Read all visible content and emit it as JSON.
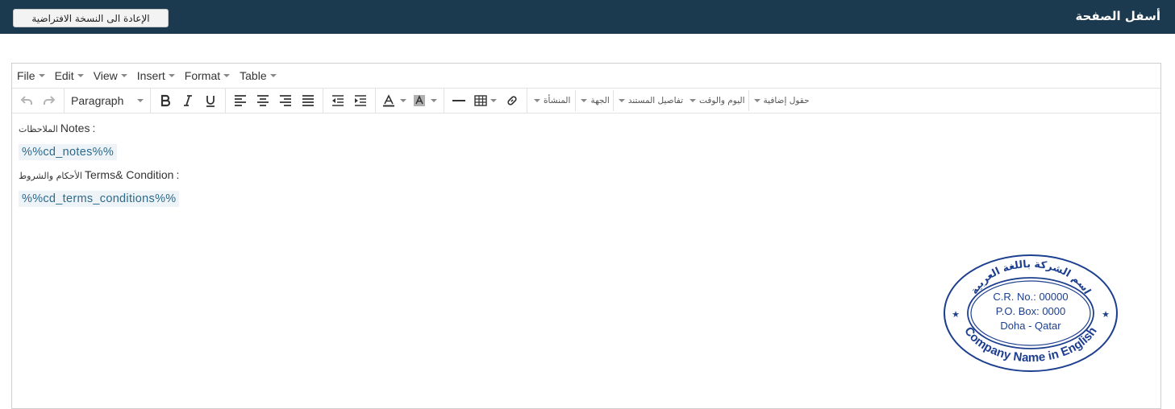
{
  "header": {
    "title": "أسفل الصفحة",
    "reset_button": "الإعادة الى النسخة الافتراضية"
  },
  "menubar": [
    {
      "label": "File"
    },
    {
      "label": "Edit"
    },
    {
      "label": "View"
    },
    {
      "label": "Insert"
    },
    {
      "label": "Format"
    },
    {
      "label": "Table"
    }
  ],
  "toolbar": {
    "block_format": "Paragraph",
    "custom_menus": [
      "المنشأة",
      "الجهة",
      "تفاصيل المستند",
      "اليوم والوقت",
      "حقول إضافية"
    ]
  },
  "content": {
    "notes_label_ar": "الملاحظات",
    "notes_label_en": "Notes",
    "notes_colon": ":",
    "notes_placeholder": "%%cd_notes%%",
    "terms_label_ar": "الأحكام والشروط",
    "terms_label_en": "Terms& Condition",
    "terms_colon": ":",
    "terms_placeholder": "%%cd_terms_conditions%%"
  },
  "stamp": {
    "arabic_name": "اسم الشركة باللغة العربية",
    "cr_line": "C.R. No.: 00000",
    "po_line": "P.O. Box: 0000",
    "city_line": "Doha - Qatar",
    "english_name": "Company Name in English",
    "color": "#1d3f8f"
  },
  "colors": {
    "header_bg": "#1b3a4f",
    "placeholder_text": "#2b6a8b",
    "placeholder_bg": "#eef3f7"
  }
}
